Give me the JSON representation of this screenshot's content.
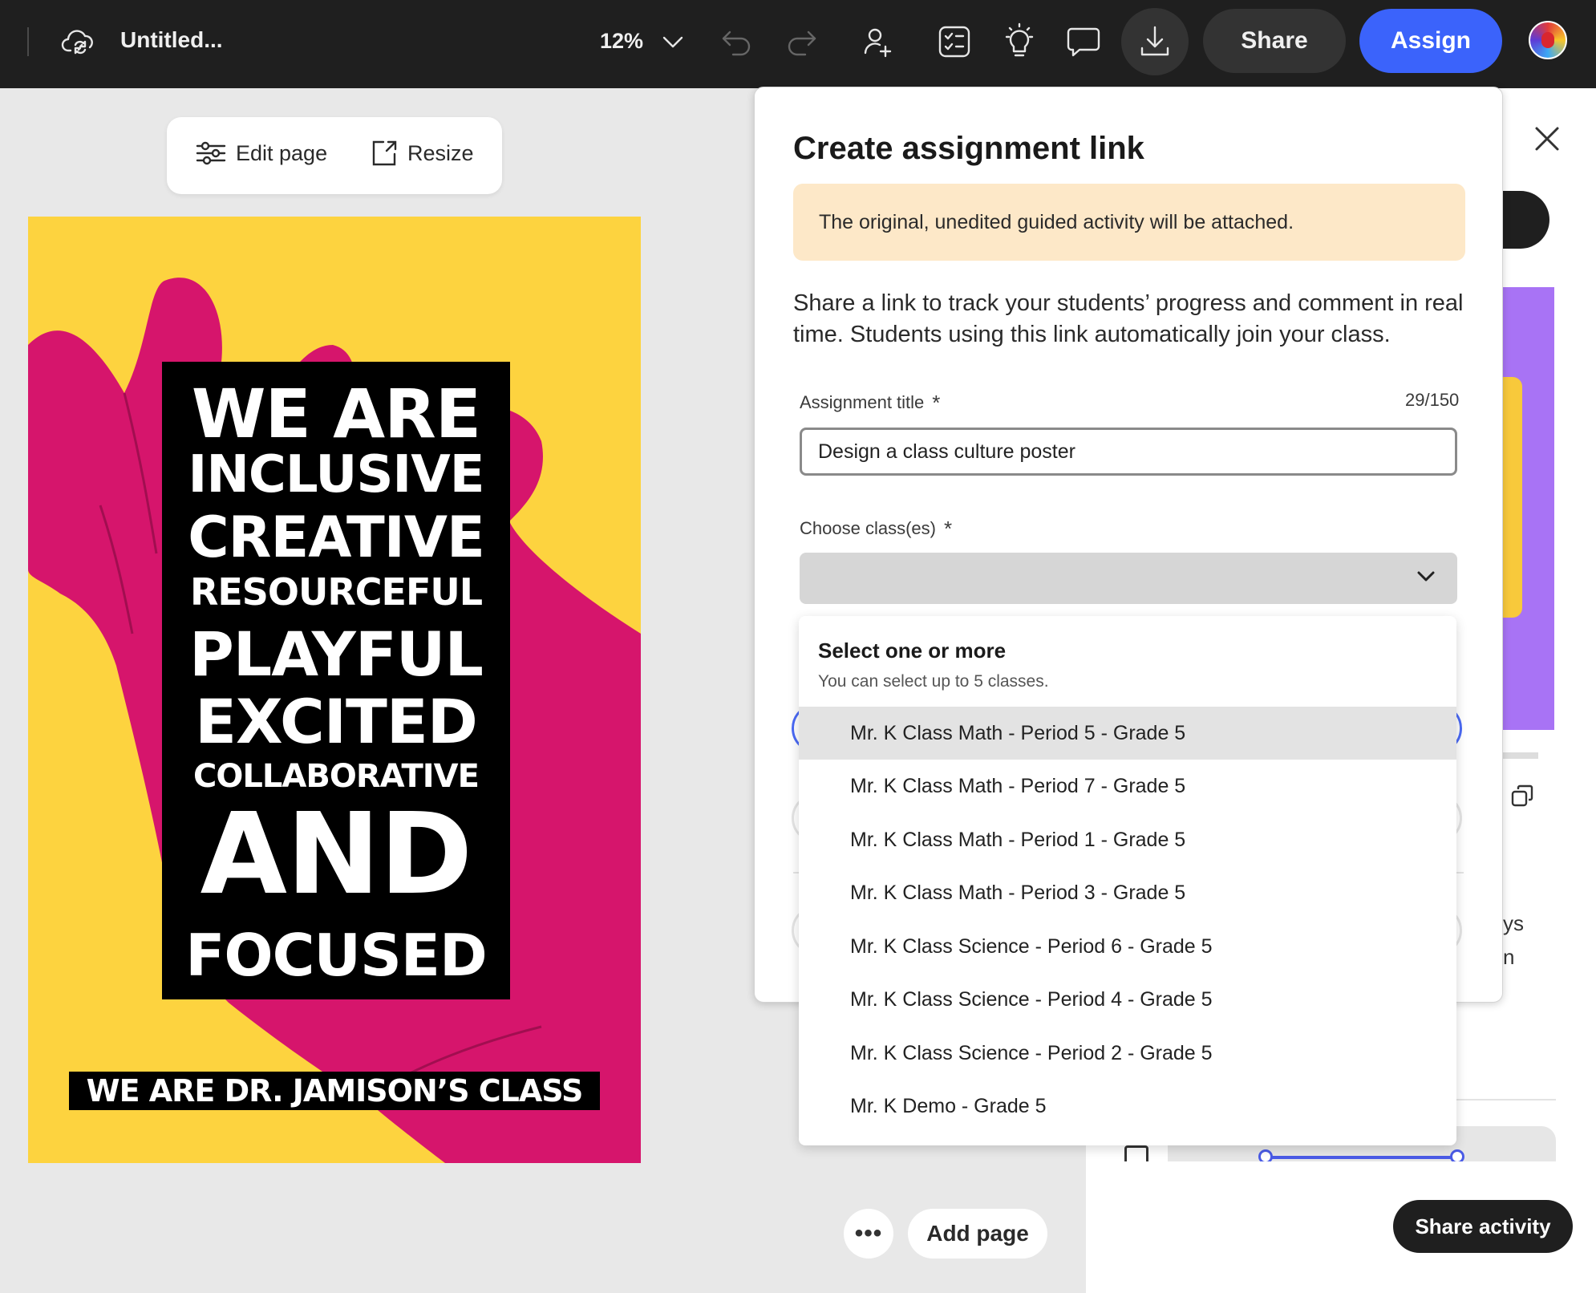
{
  "topbar": {
    "doc_title": "Untitled...",
    "zoom": "12%",
    "share_label": "Share",
    "assign_label": "Assign",
    "icons": [
      "cloud-sync-icon",
      "chevron-down-icon",
      "undo-icon",
      "redo-icon",
      "invite-user-icon",
      "checklist-icon",
      "lightbulb-icon",
      "comment-icon",
      "download-icon"
    ]
  },
  "canvas": {
    "edit_page_label": "Edit page",
    "resize_label": "Resize",
    "add_page_label": "Add page",
    "more_label": "•••",
    "poster": {
      "words": [
        "WE ARE",
        "INCLUSIVE",
        "CREATIVE",
        "RESOURCEFUL",
        "PLAYFUL",
        "EXCITED",
        "COLLABORATIVE",
        "AND",
        "FOCUSED"
      ],
      "banner": "WE ARE DR. JAMISON’S CLASS",
      "colors": {
        "background": "#fdd33f",
        "hand": "#d6156c",
        "block": "#000000"
      }
    }
  },
  "side_panel": {
    "share_activity_label": "Share activity",
    "cut_text_1": "ys",
    "cut_text_2": "n"
  },
  "modal": {
    "title": "Create assignment link",
    "notice": "The original, unedited guided activity will be attached.",
    "description": "Share a link to track your students’ progress and comment in real time. Students using this link automatically join your class.",
    "assignment_title_label": "Assignment title",
    "required_mark": "*",
    "counter": "29/150",
    "assignment_title_value": "Design a class culture poster",
    "choose_classes_label": "Choose class(es)"
  },
  "dropdown": {
    "heading": "Select one or more",
    "subtext": "You can select up to 5 classes.",
    "items": [
      "Mr. K Class Math - Period 5 - Grade 5",
      "Mr. K Class Math - Period 7 - Grade 5",
      "Mr. K Class Math - Period 1 - Grade 5",
      "Mr. K Class Math - Period 3 - Grade 5",
      "Mr. K Class Science - Period 6 - Grade 5",
      "Mr. K Class Science - Period 4 - Grade 5",
      "Mr. K Class Science - Period 2 - Grade 5",
      "Mr. K Demo - Grade 5"
    ],
    "highlighted_index": 0
  },
  "colors": {
    "accent": "#3b63fb",
    "topbar": "#1f1f1f",
    "notice_bg": "#fde8c8"
  }
}
